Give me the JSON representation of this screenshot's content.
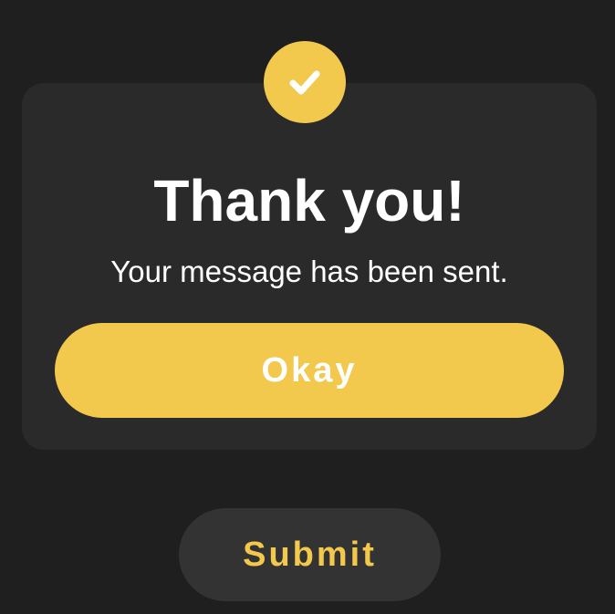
{
  "modal": {
    "icon": "checkmark-icon",
    "title": "Thank you!",
    "message": "Your message has been sent.",
    "okay_label": "Okay"
  },
  "form": {
    "submit_label": "Submit"
  },
  "colors": {
    "background": "#1f1f1f",
    "modal_background": "#2a2a2a",
    "accent": "#f2c94c",
    "text": "#ffffff",
    "submit_background": "#333333"
  }
}
